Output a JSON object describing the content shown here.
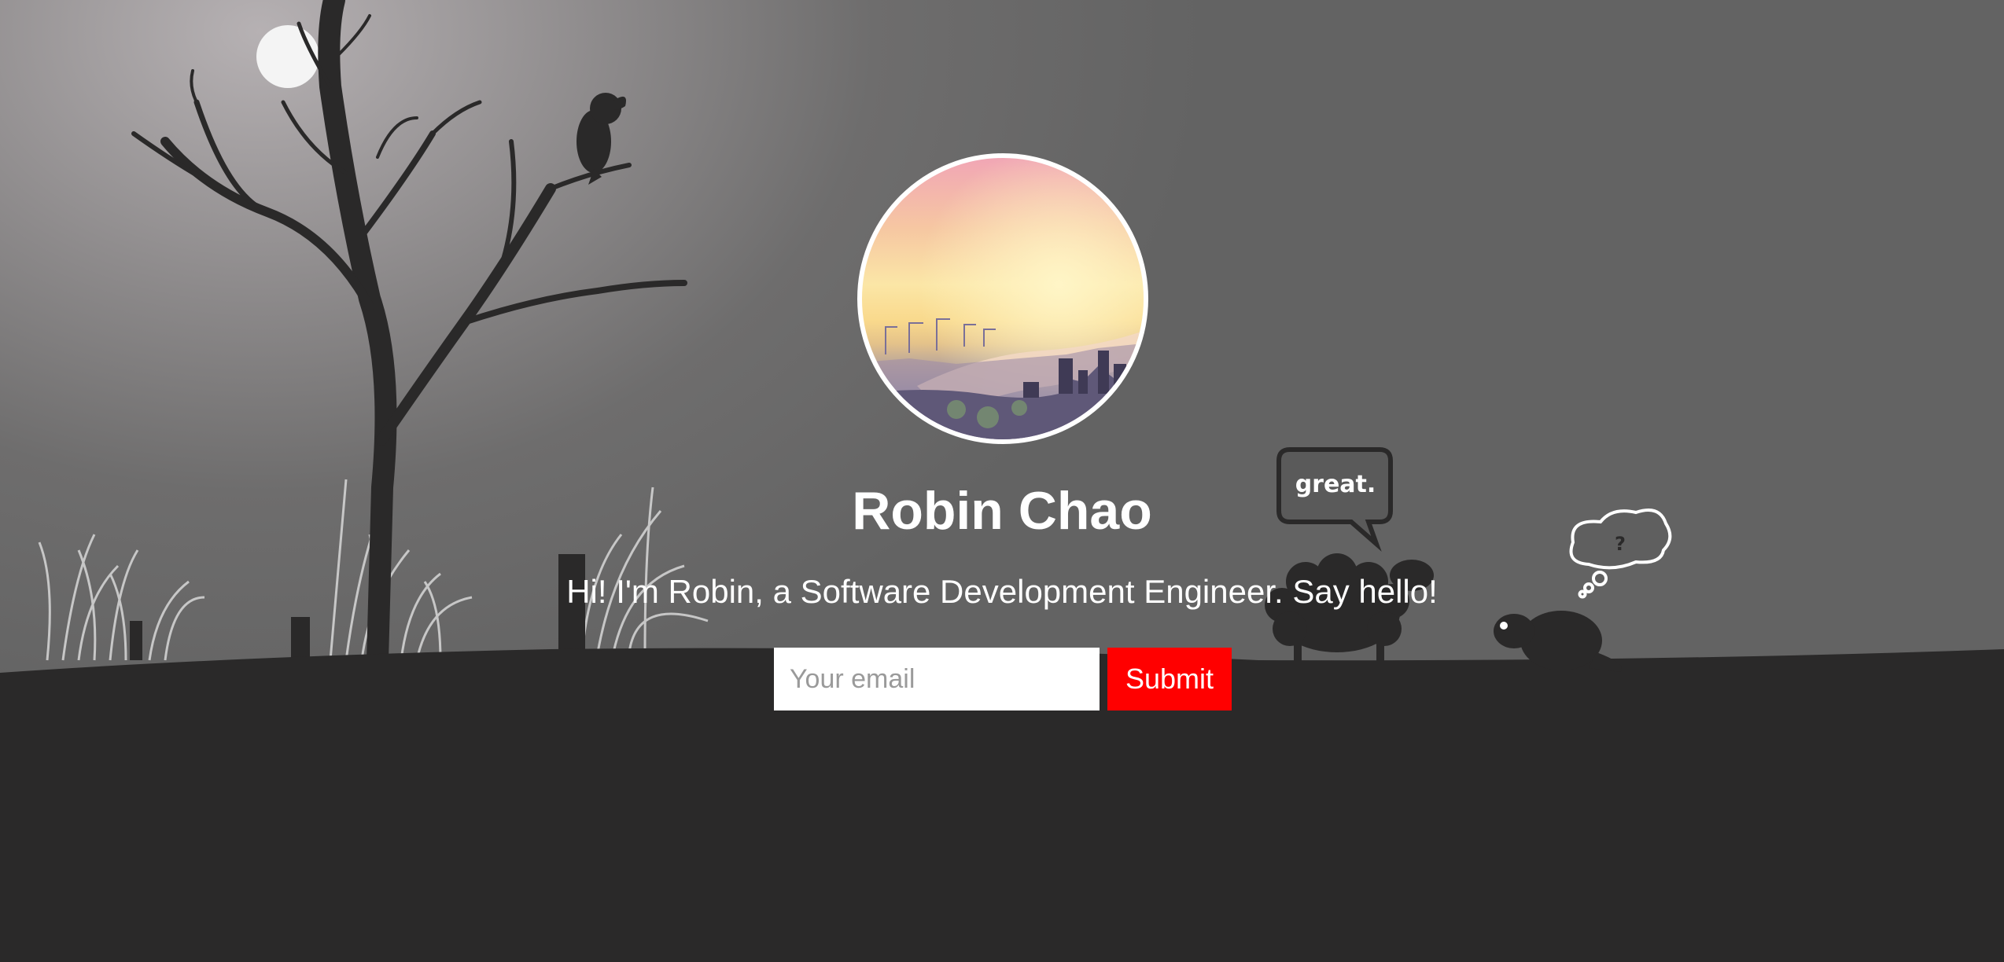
{
  "profile": {
    "name": "Robin Chao",
    "tagline": "Hi! I'm Robin, a Software Development Engineer. Say hello!",
    "avatar_icon": "city-sunset-photo"
  },
  "form": {
    "email_placeholder": "Your email",
    "submit_label": "Submit",
    "accent_color": "#ff0000"
  },
  "scene": {
    "speech_bubble_text": "great.",
    "thought_bubble_text": "?"
  }
}
